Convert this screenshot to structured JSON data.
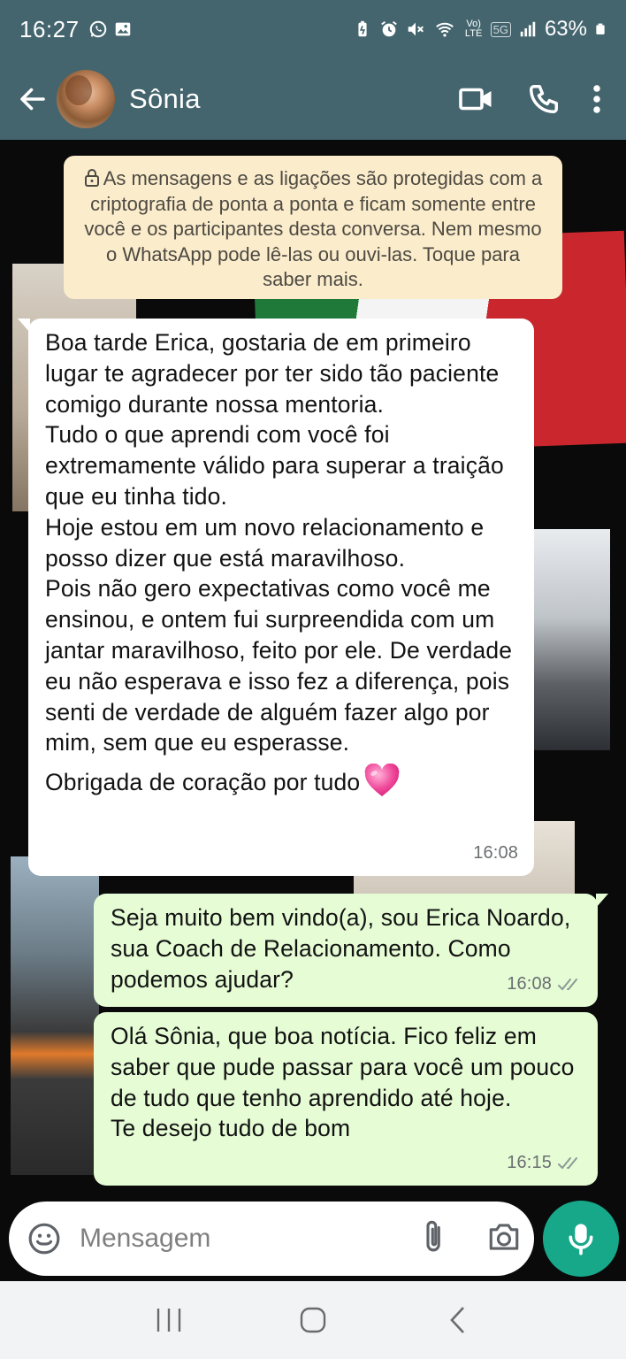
{
  "status_bar": {
    "time": "16:27",
    "network_label": "5G",
    "volte_label": "Vo) LTE",
    "battery": "63%"
  },
  "header": {
    "contact_name": "Sônia",
    "icons": [
      "back-arrow-icon",
      "video-call-icon",
      "phone-icon",
      "more-icon"
    ]
  },
  "chat": {
    "encryption_notice": "As mensagens e as ligações são protegidas com a criptografia de ponta a ponta e ficam somente entre você e os participantes desta conversa. Nem mesmo o WhatsApp pode lê-las ou ouvi-las. Toque para saber mais.",
    "messages": [
      {
        "direction": "incoming",
        "text": "Boa tarde Erica,  gostaria de em primeiro lugar te agradecer por ter sido tão paciente comigo durante nossa mentoria.\nTudo o que aprendi com você foi extremamente válido para superar a traição que eu tinha tido.\nHoje estou em um novo relacionamento e posso dizer que está maravilhoso.\nPois não gero expectativas como você me ensinou,  e ontem fui surpreendida com um jantar maravilhoso, feito por ele. De verdade eu não esperava e isso fez a diferença,  pois senti de verdade de alguém fazer algo por mim,  sem que eu esperasse.",
        "closing": "Obrigada de coração por tudo",
        "emoji": "pink-heart-icon",
        "time": "16:08"
      },
      {
        "direction": "outgoing",
        "text": "Seja muito bem vindo(a), sou Erica Noardo, sua Coach de Relacionamento. Como podemos ajudar?",
        "time": "16:08",
        "status": "read"
      },
      {
        "direction": "outgoing",
        "text": "Olá  Sônia,  que boa notícia.  Fico feliz em saber que pude passar para você um pouco de tudo que tenho aprendido até hoje.\nTe desejo tudo de bom",
        "time": "16:15",
        "status": "read"
      }
    ]
  },
  "composer": {
    "placeholder": "Mensagem"
  },
  "colors": {
    "header_bg": "#45656e",
    "outgoing_bubble": "#e5fcd5",
    "incoming_bubble": "#ffffff",
    "notice_bg": "#fbeccc",
    "accent": "#17a88a"
  }
}
